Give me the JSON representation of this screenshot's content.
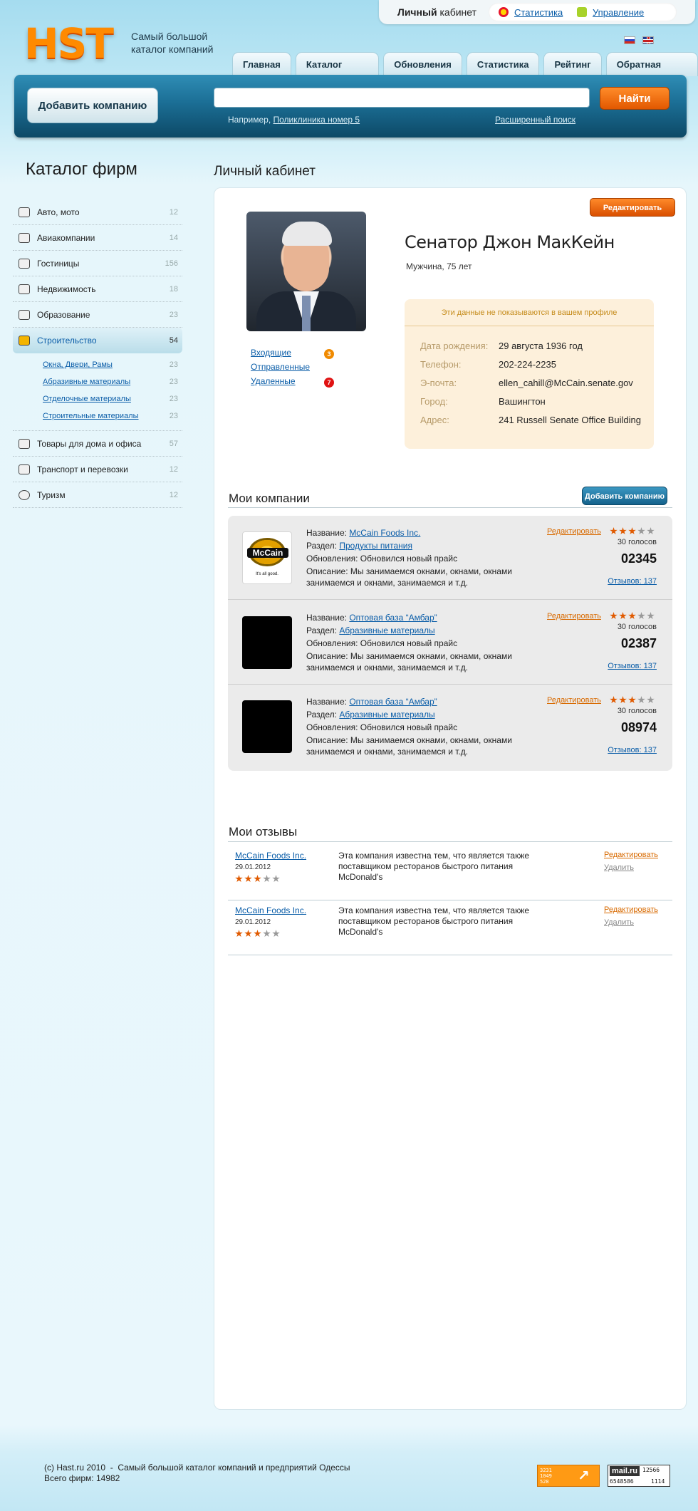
{
  "header": {
    "logo": "HST",
    "tagline": "Самый большой каталог компаний",
    "cabinet_bold": "Личный",
    "cabinet_rest": "кабинет",
    "stats_link": "Статистика",
    "manage_link": "Управление"
  },
  "nav": {
    "tabs": [
      "Главная",
      "Каталог фирм",
      "Обновления",
      "Статистика",
      "Рейтинг",
      "Обратная связь"
    ]
  },
  "search": {
    "add_company": "Добавить компанию",
    "placeholder": "",
    "button": "Найти",
    "hint_prefix": "Например,",
    "hint_example": "Поликлиника номер 5",
    "advanced": "Расширенный поиск"
  },
  "sidebar": {
    "title": "Каталог фирм",
    "categories": [
      {
        "name": "Авто, мото",
        "count": "12",
        "icon": "car-icon"
      },
      {
        "name": "Авиакомпании",
        "count": "14",
        "icon": "plane-icon"
      },
      {
        "name": "Гостиницы",
        "count": "156",
        "icon": "hotel-icon"
      },
      {
        "name": "Недвижимость",
        "count": "18",
        "icon": "house-icon"
      },
      {
        "name": "Образование",
        "count": "23",
        "icon": "books-icon"
      },
      {
        "name": "Строительство",
        "count": "54",
        "icon": "construction-icon"
      },
      {
        "name": "Товары для дома и офиса",
        "count": "57",
        "icon": "basket-icon"
      },
      {
        "name": "Транспорт и перевозки",
        "count": "12",
        "icon": "truck-icon"
      },
      {
        "name": "Туризм",
        "count": "12",
        "icon": "globe-icon"
      }
    ],
    "subcategories": [
      {
        "name": "Окна, Двери, Рамы",
        "count": "23"
      },
      {
        "name": "Абразивные материалы",
        "count": "23"
      },
      {
        "name": "Отделочные материалы",
        "count": "23"
      },
      {
        "name": "Строительные материалы",
        "count": "23"
      }
    ]
  },
  "profile": {
    "page_title": "Личный кабинет",
    "edit_button": "Редактировать",
    "name": "Сенатор Джон МакКейн",
    "meta": "Мужчина, 75 лет",
    "private_note": "Эти данные не показываются в вашем профиле",
    "fields": [
      {
        "label": "Дата рождения:",
        "value": "29 августа 1936 год"
      },
      {
        "label": "Телефон:",
        "value": "202-224-2235"
      },
      {
        "label": "Э-почта:",
        "value": "ellen_cahill@McCain.senate.gov"
      },
      {
        "label": "Город:",
        "value": "Вашингтон"
      },
      {
        "label": "Адрес:",
        "value": "241 Russell Senate Office Building"
      }
    ],
    "messages": [
      {
        "label": "Входящие",
        "badge": "3"
      },
      {
        "label": "Отправленные",
        "badge": ""
      },
      {
        "label": "Удаленные",
        "badge": "7"
      }
    ]
  },
  "companies": {
    "title": "Мои компании",
    "add_button": "Добавить компанию",
    "items": [
      {
        "name_label": "Название:",
        "name": "McCain Foods Inc.",
        "section_label": "Раздел:",
        "section": "Продукты питания",
        "updates": "Обновления: Обновился новый прайс",
        "desc": "Описание: Мы занимаемся окнами, окнами, окнами занимаемся и окнами, занимаемся и т.д.",
        "edit": "Редактировать",
        "rating": 3,
        "votes": "30 голосов",
        "number": "02345",
        "reviews": "Отзывов: 137",
        "logo_text": "McCain",
        "logo_tag": "It's all good."
      },
      {
        "name_label": "Название:",
        "name": "Оптовая база “Амбар”",
        "section_label": "Раздел:",
        "section": "Абразивные материалы",
        "updates": "Обновления: Обновился новый прайс",
        "desc": "Описание: Мы занимаемся окнами, окнами, окнами занимаемся и окнами, занимаемся и т.д.",
        "edit": "Редактировать",
        "rating": 3,
        "votes": "30 голосов",
        "number": "02387",
        "reviews": "Отзывов: 137"
      },
      {
        "name_label": "Название:",
        "name": "Оптовая база “Амбар”",
        "section_label": "Раздел:",
        "section": "Абразивные материалы",
        "updates": "Обновления: Обновился новый прайс",
        "desc": "Описание: Мы занимаемся окнами, окнами, окнами занимаемся и окнами, занимаемся и т.д.",
        "edit": "Редактировать",
        "rating": 3,
        "votes": "30 голосов",
        "number": "08974",
        "reviews": "Отзывов: 137"
      }
    ]
  },
  "reviews": {
    "title": "Мои отзывы",
    "items": [
      {
        "company": "McCain Foods Inc.",
        "date": "29.01.2012",
        "rating": 3,
        "text": "Эта компания известна тем, что является также поставщиком ресторанов быстрого питания McDonald's",
        "edit": "Редактировать",
        "delete": "Удалить"
      },
      {
        "company": "McCain Foods Inc.",
        "date": "29.01.2012",
        "rating": 3,
        "text": "Эта компания известна тем, что является также поставщиком ресторанов быстрого питания McDonald's",
        "edit": "Редактировать",
        "delete": "Удалить"
      }
    ]
  },
  "footer": {
    "copyright": "(c) Hast.ru 2010  -  Самый большой каталог компаний и предприятий Одессы",
    "total": "Всего фирм: 14982",
    "counter1_lines": [
      "3231",
      "1049",
      "528"
    ],
    "counter2_brand": "mail.ru",
    "counter2_values": [
      "12566",
      "6548586",
      "1114"
    ]
  },
  "colors": {
    "accent": "#e25800",
    "link": "#0a5da8",
    "header_bar": "#1b6e95"
  }
}
